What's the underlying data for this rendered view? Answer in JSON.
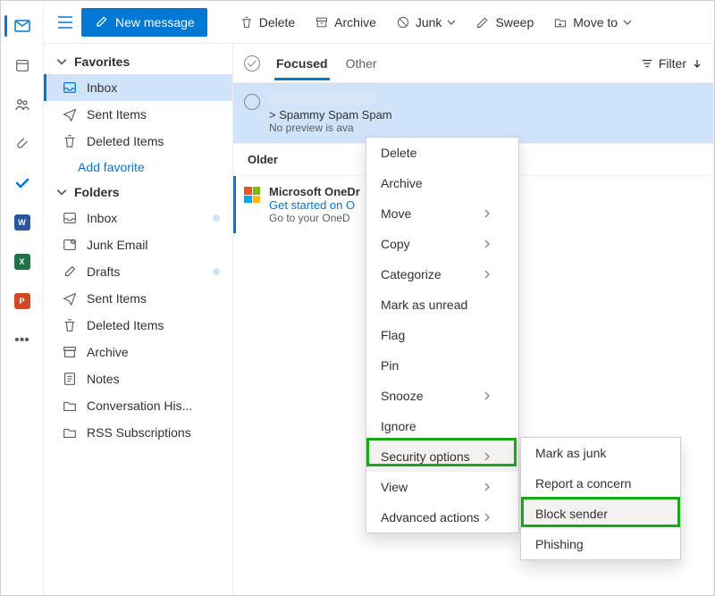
{
  "rail": {
    "word": "W",
    "excel": "X",
    "ppt": "P"
  },
  "toolbar": {
    "newMessage": "New message",
    "delete": "Delete",
    "archive": "Archive",
    "junk": "Junk",
    "sweep": "Sweep",
    "moveTo": "Move to"
  },
  "folders": {
    "favoritesHeader": "Favorites",
    "inbox": "Inbox",
    "sentItems": "Sent Items",
    "deletedItems": "Deleted Items",
    "addFavorite": "Add favorite",
    "foldersHeader": "Folders",
    "junkEmail": "Junk Email",
    "drafts": "Drafts",
    "archive": "Archive",
    "notes": "Notes",
    "conversationHistory": "Conversation His...",
    "rss": "RSS Subscriptions"
  },
  "tabs": {
    "focused": "Focused",
    "other": "Other",
    "filter": "Filter"
  },
  "messages": {
    "spamSubject": "> Spammy Spam Spam",
    "spamPreview": "No preview is ava",
    "olderHeader": "Older",
    "msSender": "Microsoft OneDr",
    "msSubject": "Get started on O",
    "msPreview": "Go to your OneD"
  },
  "ctx1": {
    "delete": "Delete",
    "archive": "Archive",
    "move": "Move",
    "copy": "Copy",
    "categorize": "Categorize",
    "markUnread": "Mark as unread",
    "flag": "Flag",
    "pin": "Pin",
    "snooze": "Snooze",
    "ignore": "Ignore",
    "security": "Security options",
    "view": "View",
    "advanced": "Advanced actions"
  },
  "ctx2": {
    "markJunk": "Mark as junk",
    "report": "Report a concern",
    "block": "Block sender",
    "phishing": "Phishing"
  }
}
